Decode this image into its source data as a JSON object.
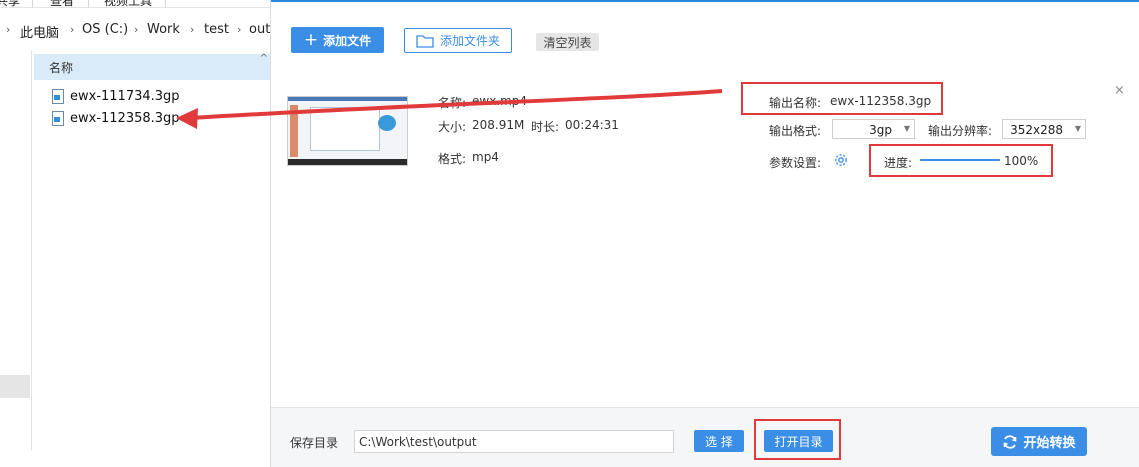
{
  "explorer": {
    "ribbon": [
      "共享",
      "查看",
      "视频工具"
    ],
    "breadcrumb": [
      "此电脑",
      "OS (C:)",
      "Work",
      "test",
      "output"
    ],
    "column_header": "名称",
    "files": [
      "ewx-111734.3gp",
      "ewx-112358.3gp"
    ]
  },
  "toolbar": {
    "add_file": "添加文件",
    "add_folder": "添加文件夹",
    "clear_list": "清空列表"
  },
  "item": {
    "name_label": "名称:",
    "name_value": "ewx.mp4",
    "size_label": "大小:",
    "size_value": "208.91M",
    "duration_label": "时长:",
    "duration_value": "00:24:31",
    "format_label": "格式:",
    "format_value": "mp4",
    "out_name_label": "输出名称:",
    "out_name_value": "ewx-112358.3gp",
    "out_format_label": "输出格式:",
    "out_format_value": "3gp",
    "out_res_label": "输出分辨率:",
    "out_res_value": "352x288",
    "params_label": "参数设置:",
    "progress_label": "进度:",
    "progress_value": "100%",
    "close": "×"
  },
  "footer": {
    "save_dir_label": "保存目录",
    "save_dir_value": "C:\\Work\\test\\output",
    "choose": "选 择",
    "open_dir": "打开目录",
    "start": "开始转换"
  },
  "colors": {
    "accent": "#3a8ee6",
    "highlight": "#e03a3a",
    "header_bg": "#d9ebf9"
  }
}
